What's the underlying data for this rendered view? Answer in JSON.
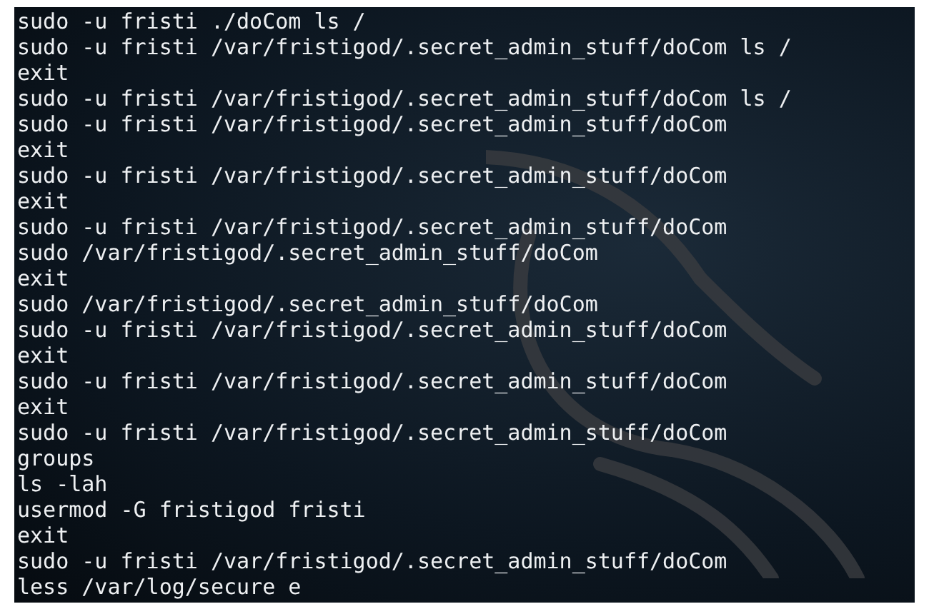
{
  "terminal": {
    "lines": [
      "sudo -u fristi ./doCom ls /",
      "sudo -u fristi /var/fristigod/.secret_admin_stuff/doCom ls /",
      "exit",
      "sudo -u fristi /var/fristigod/.secret_admin_stuff/doCom ls /",
      "sudo -u fristi /var/fristigod/.secret_admin_stuff/doCom",
      "exit",
      "sudo -u fristi /var/fristigod/.secret_admin_stuff/doCom",
      "exit",
      "sudo -u fristi /var/fristigod/.secret_admin_stuff/doCom",
      "sudo /var/fristigod/.secret_admin_stuff/doCom",
      "exit",
      "sudo /var/fristigod/.secret_admin_stuff/doCom",
      "sudo -u fristi /var/fristigod/.secret_admin_stuff/doCom",
      "exit",
      "sudo -u fristi /var/fristigod/.secret_admin_stuff/doCom",
      "exit",
      "sudo -u fristi /var/fristigod/.secret_admin_stuff/doCom",
      "groups",
      "ls -lah",
      "usermod -G fristigod fristi",
      "exit",
      "sudo -u fristi /var/fristigod/.secret_admin_stuff/doCom",
      "less /var/log/secure e"
    ]
  }
}
